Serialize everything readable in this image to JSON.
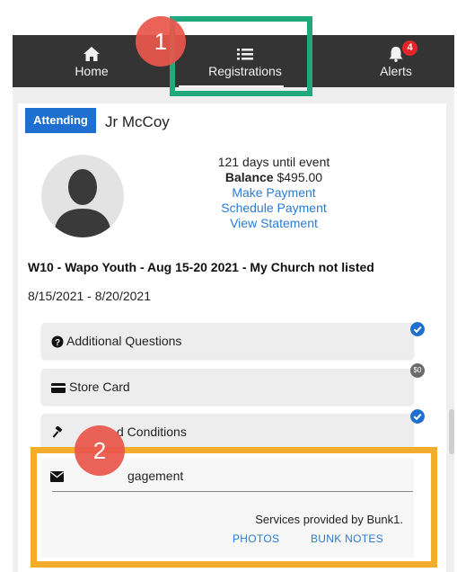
{
  "nav": {
    "items": [
      {
        "label": "Home",
        "icon": "home-icon"
      },
      {
        "label": "Registrations",
        "icon": "list-icon"
      },
      {
        "label": "Alerts",
        "icon": "bell-icon",
        "badge": "4"
      }
    ]
  },
  "registration": {
    "tag": "Attending",
    "name": "Jr McCoy",
    "days_until": "121 days until event",
    "balance_label": "Balance",
    "balance_value": "$495.00",
    "links": [
      "Make Payment",
      "Schedule Payment",
      "View Statement"
    ],
    "event_title": "W10 - Wapo Youth - Aug 15-20 2021 - My Church not listed",
    "event_dates": "8/15/2021 - 8/20/2021"
  },
  "sections": [
    {
      "label": "Additional Questions",
      "icon": "question-circle-icon",
      "status": "check"
    },
    {
      "label": "Store Card",
      "icon": "credit-card-icon",
      "status": "$0"
    },
    {
      "label": "d Conditions",
      "icon": "gavel-icon",
      "status": "check"
    }
  ],
  "engagement": {
    "header": "gagement",
    "services": "Services provided by Bunk1.",
    "links": [
      "PHOTOS",
      "BUNK NOTES"
    ]
  },
  "callouts": [
    "1",
    "2"
  ],
  "colors": {
    "nav_bg": "#343434",
    "accent_blue": "#1e6fcf",
    "highlight_green": "#1fa97d",
    "highlight_orange": "#f4ad2a",
    "callout_red": "#e9564c"
  }
}
